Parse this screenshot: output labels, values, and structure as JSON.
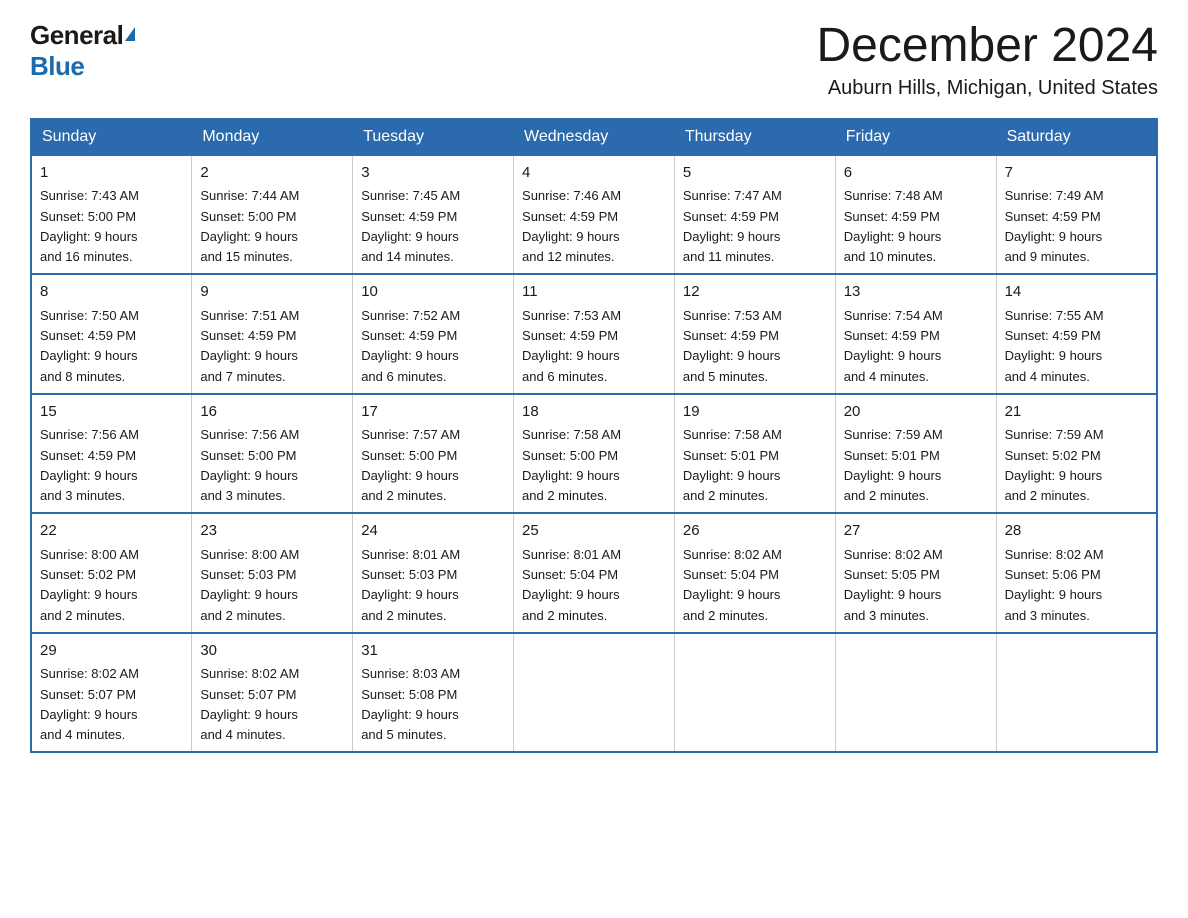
{
  "logo": {
    "general": "General",
    "blue": "Blue"
  },
  "title": {
    "month": "December 2024",
    "location": "Auburn Hills, Michigan, United States"
  },
  "weekdays": [
    "Sunday",
    "Monday",
    "Tuesday",
    "Wednesday",
    "Thursday",
    "Friday",
    "Saturday"
  ],
  "weeks": [
    [
      {
        "day": "1",
        "sunrise": "7:43 AM",
        "sunset": "5:00 PM",
        "daylight": "9 hours and 16 minutes."
      },
      {
        "day": "2",
        "sunrise": "7:44 AM",
        "sunset": "5:00 PM",
        "daylight": "9 hours and 15 minutes."
      },
      {
        "day": "3",
        "sunrise": "7:45 AM",
        "sunset": "4:59 PM",
        "daylight": "9 hours and 14 minutes."
      },
      {
        "day": "4",
        "sunrise": "7:46 AM",
        "sunset": "4:59 PM",
        "daylight": "9 hours and 12 minutes."
      },
      {
        "day": "5",
        "sunrise": "7:47 AM",
        "sunset": "4:59 PM",
        "daylight": "9 hours and 11 minutes."
      },
      {
        "day": "6",
        "sunrise": "7:48 AM",
        "sunset": "4:59 PM",
        "daylight": "9 hours and 10 minutes."
      },
      {
        "day": "7",
        "sunrise": "7:49 AM",
        "sunset": "4:59 PM",
        "daylight": "9 hours and 9 minutes."
      }
    ],
    [
      {
        "day": "8",
        "sunrise": "7:50 AM",
        "sunset": "4:59 PM",
        "daylight": "9 hours and 8 minutes."
      },
      {
        "day": "9",
        "sunrise": "7:51 AM",
        "sunset": "4:59 PM",
        "daylight": "9 hours and 7 minutes."
      },
      {
        "day": "10",
        "sunrise": "7:52 AM",
        "sunset": "4:59 PM",
        "daylight": "9 hours and 6 minutes."
      },
      {
        "day": "11",
        "sunrise": "7:53 AM",
        "sunset": "4:59 PM",
        "daylight": "9 hours and 6 minutes."
      },
      {
        "day": "12",
        "sunrise": "7:53 AM",
        "sunset": "4:59 PM",
        "daylight": "9 hours and 5 minutes."
      },
      {
        "day": "13",
        "sunrise": "7:54 AM",
        "sunset": "4:59 PM",
        "daylight": "9 hours and 4 minutes."
      },
      {
        "day": "14",
        "sunrise": "7:55 AM",
        "sunset": "4:59 PM",
        "daylight": "9 hours and 4 minutes."
      }
    ],
    [
      {
        "day": "15",
        "sunrise": "7:56 AM",
        "sunset": "4:59 PM",
        "daylight": "9 hours and 3 minutes."
      },
      {
        "day": "16",
        "sunrise": "7:56 AM",
        "sunset": "5:00 PM",
        "daylight": "9 hours and 3 minutes."
      },
      {
        "day": "17",
        "sunrise": "7:57 AM",
        "sunset": "5:00 PM",
        "daylight": "9 hours and 2 minutes."
      },
      {
        "day": "18",
        "sunrise": "7:58 AM",
        "sunset": "5:00 PM",
        "daylight": "9 hours and 2 minutes."
      },
      {
        "day": "19",
        "sunrise": "7:58 AM",
        "sunset": "5:01 PM",
        "daylight": "9 hours and 2 minutes."
      },
      {
        "day": "20",
        "sunrise": "7:59 AM",
        "sunset": "5:01 PM",
        "daylight": "9 hours and 2 minutes."
      },
      {
        "day": "21",
        "sunrise": "7:59 AM",
        "sunset": "5:02 PM",
        "daylight": "9 hours and 2 minutes."
      }
    ],
    [
      {
        "day": "22",
        "sunrise": "8:00 AM",
        "sunset": "5:02 PM",
        "daylight": "9 hours and 2 minutes."
      },
      {
        "day": "23",
        "sunrise": "8:00 AM",
        "sunset": "5:03 PM",
        "daylight": "9 hours and 2 minutes."
      },
      {
        "day": "24",
        "sunrise": "8:01 AM",
        "sunset": "5:03 PM",
        "daylight": "9 hours and 2 minutes."
      },
      {
        "day": "25",
        "sunrise": "8:01 AM",
        "sunset": "5:04 PM",
        "daylight": "9 hours and 2 minutes."
      },
      {
        "day": "26",
        "sunrise": "8:02 AM",
        "sunset": "5:04 PM",
        "daylight": "9 hours and 2 minutes."
      },
      {
        "day": "27",
        "sunrise": "8:02 AM",
        "sunset": "5:05 PM",
        "daylight": "9 hours and 3 minutes."
      },
      {
        "day": "28",
        "sunrise": "8:02 AM",
        "sunset": "5:06 PM",
        "daylight": "9 hours and 3 minutes."
      }
    ],
    [
      {
        "day": "29",
        "sunrise": "8:02 AM",
        "sunset": "5:07 PM",
        "daylight": "9 hours and 4 minutes."
      },
      {
        "day": "30",
        "sunrise": "8:02 AM",
        "sunset": "5:07 PM",
        "daylight": "9 hours and 4 minutes."
      },
      {
        "day": "31",
        "sunrise": "8:03 AM",
        "sunset": "5:08 PM",
        "daylight": "9 hours and 5 minutes."
      },
      null,
      null,
      null,
      null
    ]
  ],
  "labels": {
    "sunrise": "Sunrise:",
    "sunset": "Sunset:",
    "daylight": "Daylight:"
  }
}
